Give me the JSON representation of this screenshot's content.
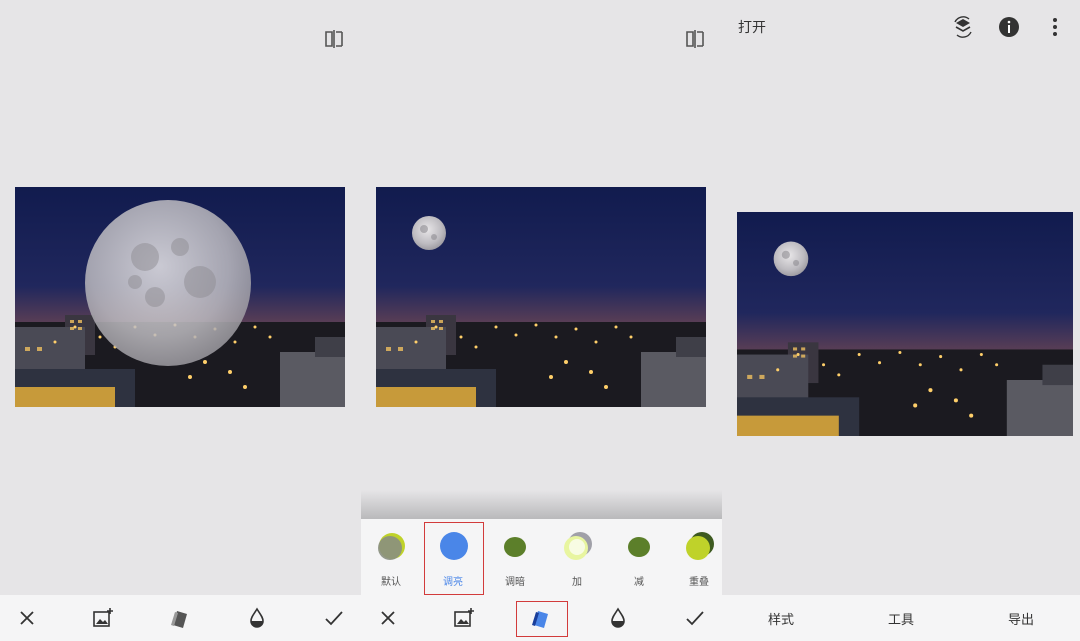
{
  "panel_left": {
    "toolbar": {
      "close_icon": "close-icon",
      "add_image_icon": "add-image-icon",
      "blend_modes_icon": "blend-modes-icon",
      "opacity_icon": "opacity-icon",
      "confirm_icon": "check-icon"
    },
    "compare_icon": "compare-icon"
  },
  "panel_middle": {
    "compare_icon": "compare-icon",
    "blend_modes": [
      {
        "label": "默认",
        "selected": false,
        "swatch": "default"
      },
      {
        "label": "调亮",
        "selected": true,
        "swatch": "lighten"
      },
      {
        "label": "调暗",
        "selected": false,
        "swatch": "darken"
      },
      {
        "label": "加",
        "selected": false,
        "swatch": "add"
      },
      {
        "label": "减",
        "selected": false,
        "swatch": "subtract"
      },
      {
        "label": "重叠",
        "selected": false,
        "swatch": "overlay"
      }
    ],
    "toolbar": {
      "close_icon": "close-icon",
      "add_image_icon": "add-image-icon",
      "blend_modes_icon": "blend-modes-icon",
      "blend_modes_active": true,
      "opacity_icon": "opacity-icon",
      "confirm_icon": "check-icon"
    }
  },
  "panel_right": {
    "header": {
      "title": "打开",
      "layers_icon": "layers-icon",
      "info_icon": "info-icon",
      "more_icon": "more-vert-icon"
    },
    "nav": {
      "styles": "样式",
      "tools": "工具",
      "export": "导出"
    }
  },
  "colors": {
    "background": "#e6e5e7",
    "accent": "#4a86e8",
    "highlight_border": "#d23b3b",
    "swatch_green": "#5c7f2a",
    "swatch_lime": "#bfd22a"
  }
}
